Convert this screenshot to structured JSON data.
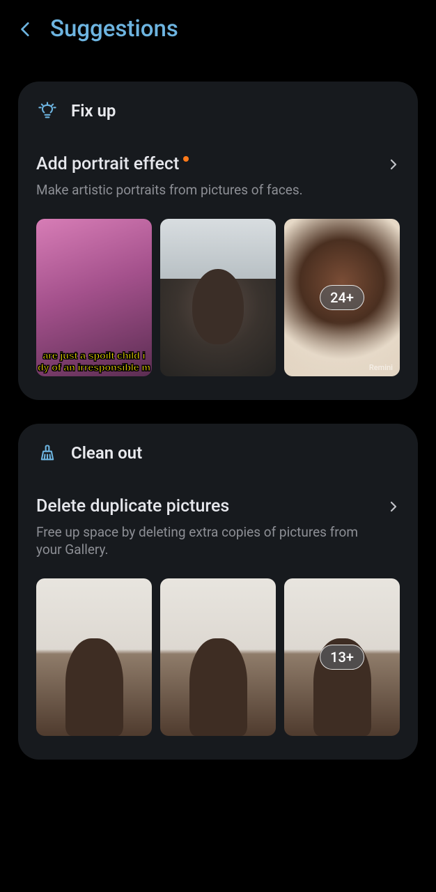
{
  "header": {
    "title": "Suggestions"
  },
  "cards": [
    {
      "section_title": "Fix up",
      "action_title": "Add portrait effect",
      "action_desc": "Make artistic portraits from pictures of faces.",
      "has_dot": true,
      "thumbs": {
        "overflow_badge": "24+",
        "watermark": "Remini",
        "meme_line1": "are just a spoilt child i",
        "meme_line2": "dy of an irresponsible m"
      }
    },
    {
      "section_title": "Clean out",
      "action_title": "Delete duplicate pictures",
      "action_desc": "Free up space by deleting extra copies of pictures from your Gallery.",
      "has_dot": false,
      "thumbs": {
        "overflow_badge": "13+"
      }
    }
  ]
}
